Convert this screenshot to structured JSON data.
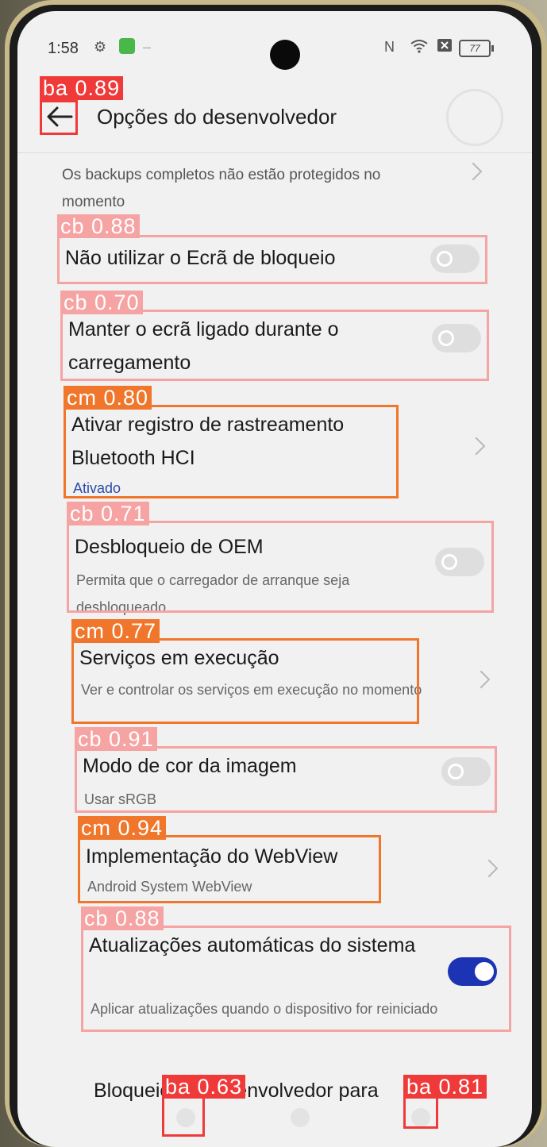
{
  "status_bar": {
    "time": "1:58",
    "battery": "77"
  },
  "header": {
    "title": "Opções do desenvolvedor"
  },
  "items": [
    {
      "subtitle": "Os backups completos não estão protegidos no momento",
      "control": "chevron"
    },
    {
      "title": "Não utilizar o Ecrã de bloqueio",
      "control": "toggle",
      "checked": false
    },
    {
      "title": "Manter o ecrã ligado durante o carregamento",
      "control": "toggle",
      "checked": false
    },
    {
      "title": "Ativar registro de rastreamento Bluetooth HCI",
      "subtitle": "Ativado",
      "control": "chevron"
    },
    {
      "title": "Desbloqueio de OEM",
      "subtitle": "Permita que o carregador de arranque seja desbloqueado.",
      "control": "toggle",
      "checked": false
    },
    {
      "title": "Serviços em execução",
      "subtitle": "Ver e controlar os serviços em execução no momento",
      "control": "chevron"
    },
    {
      "title": "Modo de cor da imagem",
      "subtitle": "Usar sRGB",
      "control": "toggle",
      "checked": false
    },
    {
      "title": "Implementação do WebView",
      "subtitle": "Android System WebView",
      "control": "chevron"
    },
    {
      "title": "Atualizações automáticas do sistema",
      "subtitle": "Aplicar atualizações quando o dispositivo for reiniciado",
      "control": "toggle",
      "checked": true
    },
    {
      "title": "Bloqueio de desenvolvedor para"
    }
  ],
  "detections": [
    {
      "label": "ba 0.89"
    },
    {
      "label": "cb 0.88"
    },
    {
      "label": "cb 0.70"
    },
    {
      "label": "cm 0.80"
    },
    {
      "label": "cb 0.71"
    },
    {
      "label": "cm 0.77"
    },
    {
      "label": "cb 0.91"
    },
    {
      "label": "cm 0.94"
    },
    {
      "label": "cb 0.88"
    },
    {
      "label": "ba 0.63"
    },
    {
      "label": "ba 0.81"
    }
  ],
  "colors": {
    "toggle_on": "#1c34b3",
    "det_cb": "#f6a3a3",
    "det_cm": "#f0762b",
    "det_ba": "#f03a3a"
  }
}
